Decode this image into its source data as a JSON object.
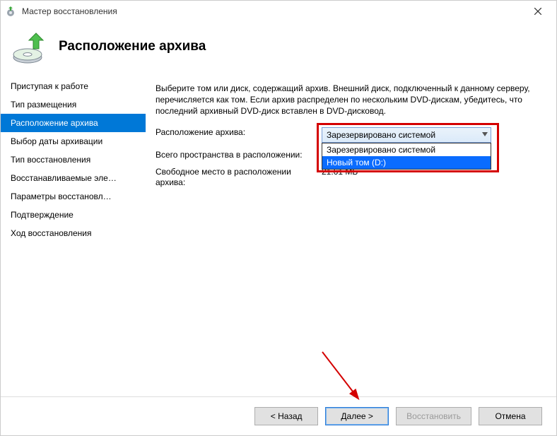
{
  "window": {
    "title": "Мастер восстановления"
  },
  "header": {
    "heading": "Расположение архива"
  },
  "sidebar": {
    "items": [
      {
        "label": "Приступая к работе"
      },
      {
        "label": "Тип размещения"
      },
      {
        "label": "Расположение архива"
      },
      {
        "label": "Выбор даты архивации"
      },
      {
        "label": "Тип восстановления"
      },
      {
        "label": "Восстанавливаемые эле…"
      },
      {
        "label": "Параметры восстановл…"
      },
      {
        "label": "Подтверждение"
      },
      {
        "label": "Ход восстановления"
      }
    ],
    "selected_index": 2
  },
  "content": {
    "instruction": "Выберите том или диск, содержащий архив. Внешний диск, подключенный к данному серверу, перечисляется как том. Если архив распределен по нескольким DVD-дискам, убедитесь, что последний архивный DVD-диск вставлен в DVD-дисковод.",
    "rows": {
      "location_label": "Расположение архива:",
      "total_label": "Всего пространства в расположении:",
      "free_label": "Свободное место в расположении архива:",
      "free_value": "21.61 МБ"
    },
    "combobox": {
      "selected": "Зарезервировано системой",
      "options": [
        "Зарезервировано системой",
        "Новый том (D:)"
      ],
      "highlight_index": 1
    }
  },
  "footer": {
    "back": "< Назад",
    "next": "Далее >",
    "restore": "Восстановить",
    "cancel": "Отмена"
  },
  "icons": {
    "app_icon_name": "restore-wizard-icon",
    "header_icon_name": "restore-disc-icon",
    "close_name": "close-icon",
    "chevron_name": "chevron-down-icon"
  }
}
